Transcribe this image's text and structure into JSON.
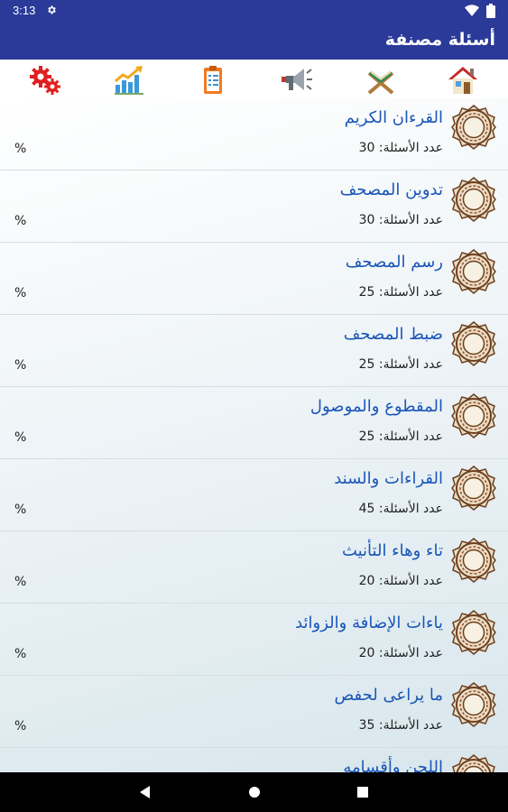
{
  "status": {
    "time": "3:13",
    "icons": [
      "settings-gear-icon",
      "wifi-icon",
      "battery-icon"
    ]
  },
  "app_bar": {
    "title": "أسئلة مصنفة"
  },
  "toolbar": {
    "icons": [
      "home-icon",
      "quran-icon",
      "megaphone-icon",
      "clipboard-icon",
      "chart-growth-icon",
      "settings-gears-icon"
    ]
  },
  "categories": [
    {
      "name": "القرءان الكريم",
      "count_label": "عدد الأسئلة: 30",
      "percent": "%"
    },
    {
      "name": "تدوين المصحف",
      "count_label": "عدد الأسئلة: 30",
      "percent": "%"
    },
    {
      "name": "رسم المصحف",
      "count_label": "عدد الأسئلة: 25",
      "percent": "%"
    },
    {
      "name": "ضبط المصحف",
      "count_label": "عدد الأسئلة: 25",
      "percent": "%"
    },
    {
      "name": "المقطوع والموصول",
      "count_label": "عدد الأسئلة: 25",
      "percent": "%"
    },
    {
      "name": "القراءات والسند",
      "count_label": "عدد الأسئلة: 45",
      "percent": "%"
    },
    {
      "name": "تاء وهاء التأنيث",
      "count_label": "عدد الأسئلة: 20",
      "percent": "%"
    },
    {
      "name": "ياءات الإضافة والزوائد",
      "count_label": "عدد الأسئلة: 20",
      "percent": "%"
    },
    {
      "name": "ما يراعى لحفص",
      "count_label": "عدد الأسئلة: 35",
      "percent": "%"
    },
    {
      "name": "اللحن وأقسامه",
      "count_label": "",
      "percent": ""
    }
  ],
  "colors": {
    "primary": "#2b3a98",
    "link_blue": "#1a56b8"
  }
}
